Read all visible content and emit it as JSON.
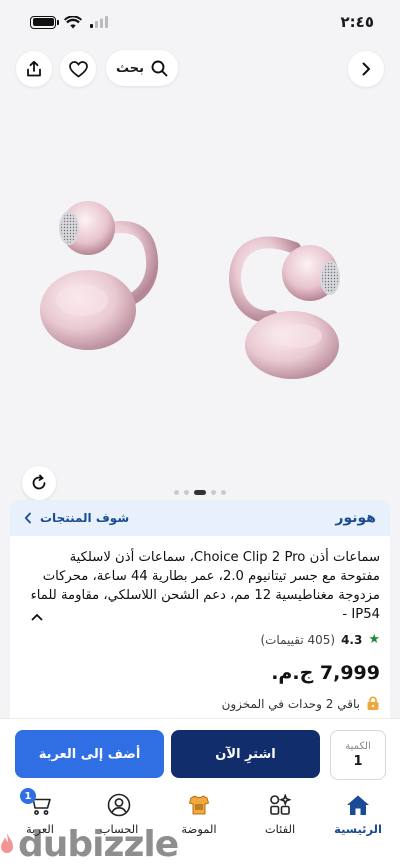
{
  "status_bar": {
    "time": "٢:٤٥"
  },
  "header": {
    "search_label": "بحث",
    "icons": {
      "back": "chevron-right-icon",
      "search": "search-icon",
      "favorite": "heart-icon",
      "share": "share-icon"
    }
  },
  "gallery": {
    "image_count": 5,
    "active_index": 3
  },
  "brand": {
    "name": "هونور",
    "see_products_label": "شوف المنتجات"
  },
  "product": {
    "title": "سماعات أذن Choice Clip 2 Pro، سماعات أذن لاسلكية مفتوحة مع جسر تيتانيوم 2.0، عمر بطارية 44 ساعة، محركات مزدوجة مغناطيسية 12 مم، دعم الشحن اللاسلكي، مقاومة للماء IP54 -",
    "rating": "4.3",
    "reviews": "(405 تقييمات)",
    "price": "7,999 ج.م.",
    "stock_note": "باقي 2 وحدات في المخزون"
  },
  "actions": {
    "qty_label": "الكمية",
    "qty_value": "1",
    "buy_now_label": "اشترِ الآن",
    "add_to_cart_label": "أضف إلى العربة"
  },
  "nav": {
    "items": [
      {
        "label": "الرئيسية",
        "icon": "home-icon",
        "active": true
      },
      {
        "label": "الفئات",
        "icon": "categories-icon"
      },
      {
        "label": "الموضة",
        "icon": "fashion-icon"
      },
      {
        "label": "الحساب",
        "icon": "account-icon"
      },
      {
        "label": "العربة",
        "icon": "cart-icon",
        "badge": "1"
      }
    ]
  },
  "watermark": {
    "text": "dubizzle"
  },
  "colors": {
    "primary_dark": "#122d6b",
    "primary": "#2f6fe3",
    "brand_text": "#1a4b96",
    "rating_green": "#1e8a3a"
  }
}
